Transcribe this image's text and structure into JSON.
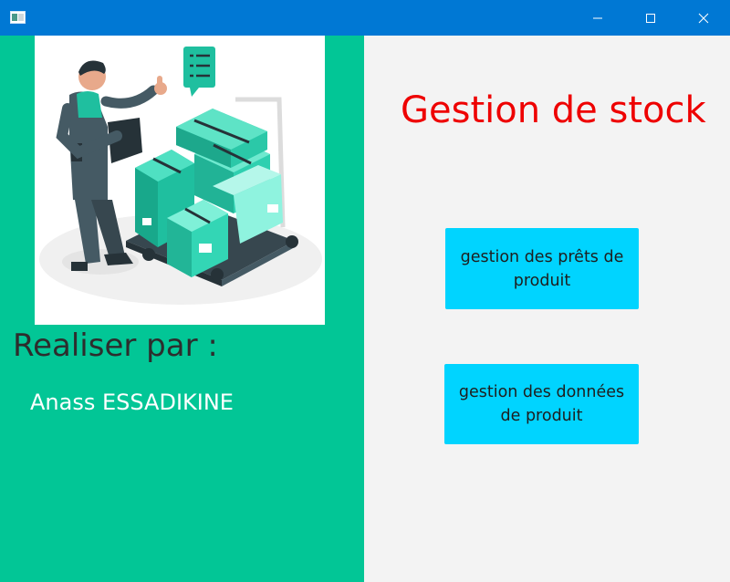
{
  "window": {
    "titlebar_color": "#0078d4",
    "controls": [
      "minimize-icon",
      "maximize-icon",
      "close-icon"
    ]
  },
  "sidebar": {
    "background": "#02c696",
    "illustration": "warehouse-worker-with-boxes-illustration",
    "author_heading": "Realiser par :",
    "author_name": "Anass ESSADIKINE"
  },
  "main": {
    "title": "Gestion de stock",
    "title_color": "#ee0000",
    "buttons": [
      {
        "label": "gestion des prêts de produit"
      },
      {
        "label": "gestion des données de produit"
      }
    ],
    "button_color": "#00d4ff"
  }
}
